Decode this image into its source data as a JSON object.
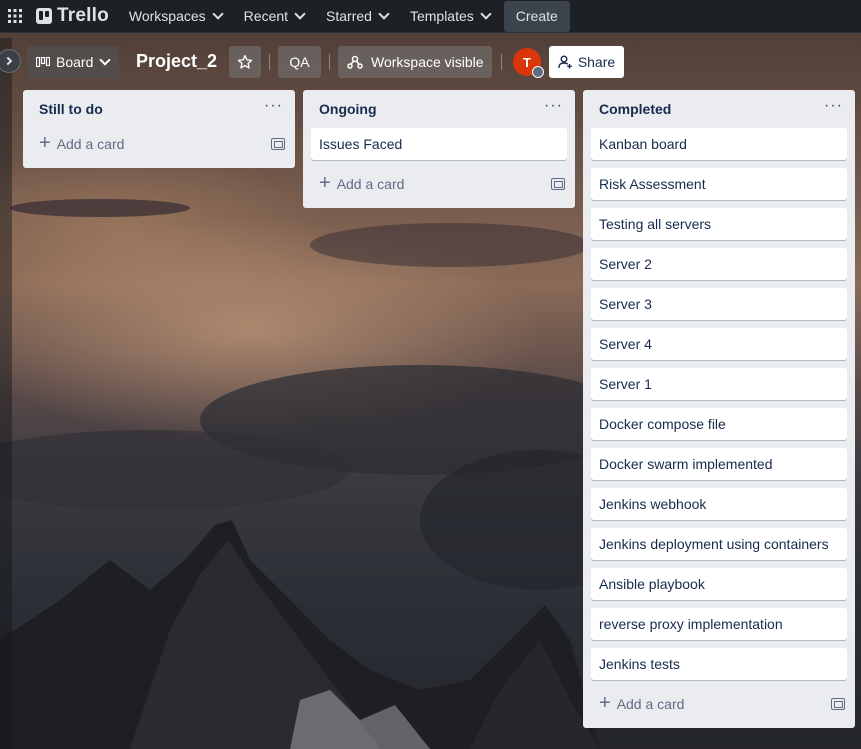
{
  "nav": {
    "logo": "Trello",
    "menus": [
      "Workspaces",
      "Recent",
      "Starred",
      "Templates"
    ],
    "create": "Create"
  },
  "board_header": {
    "view": "Board",
    "title": "Project_2",
    "workspace_name": "QA",
    "visibility": "Workspace visible",
    "avatar_initial": "T",
    "share": "Share"
  },
  "lists": [
    {
      "title": "Still to do",
      "cards": [],
      "add_label": "Add a card"
    },
    {
      "title": "Ongoing",
      "cards": [
        "Issues Faced"
      ],
      "add_label": "Add a card"
    },
    {
      "title": "Completed",
      "cards": [
        "Kanban board",
        "Risk Assessment",
        "Testing all servers",
        "Server 2",
        "Server 3",
        "Server 4",
        "Server 1",
        "Docker compose file",
        "Docker swarm implemented",
        "Jenkins webhook",
        "Jenkins deployment using containers",
        "Ansible playbook",
        "reverse proxy implementation",
        "Jenkins tests"
      ],
      "add_label": "Add a card"
    }
  ],
  "colors": {
    "nav_bg": "#1d2125",
    "list_bg": "#ebecf0",
    "avatar": "#d9360a"
  }
}
